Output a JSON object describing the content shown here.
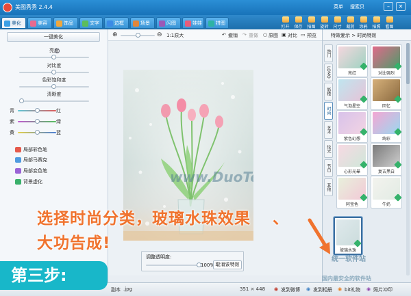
{
  "app": {
    "title": "美图秀秀 2.4.4",
    "menu_label": "菜单",
    "login_label": "搜索贝",
    "minimize": "–",
    "close": "✕"
  },
  "tabs": [
    {
      "label": "美化",
      "icon": "beautify-icon",
      "active": true
    },
    {
      "label": "美容",
      "icon": "makeup-icon",
      "active": false
    },
    {
      "label": "饰品",
      "icon": "accessory-icon",
      "active": false
    },
    {
      "label": "文字",
      "icon": "text-icon",
      "active": false
    },
    {
      "label": "边框",
      "icon": "frame-icon",
      "active": false
    },
    {
      "label": "场景",
      "icon": "scene-icon",
      "active": false
    },
    {
      "label": "闪图",
      "icon": "flash-icon",
      "active": false
    },
    {
      "label": "娃娃",
      "icon": "doll-icon",
      "active": false
    },
    {
      "label": "拼图",
      "icon": "puzzle-icon",
      "active": false
    }
  ],
  "toolbar": [
    {
      "label": "打开",
      "icon": "open-icon"
    },
    {
      "label": "保存",
      "icon": "save-icon"
    },
    {
      "label": "拍图",
      "icon": "camera-icon"
    },
    {
      "label": "旋转",
      "icon": "rotate-icon"
    },
    {
      "label": "尺寸",
      "icon": "resize-icon"
    },
    {
      "label": "裁剪",
      "icon": "crop-icon"
    },
    {
      "label": "涂鸦",
      "icon": "doodle-icon"
    },
    {
      "label": "拍照",
      "icon": "photo-icon"
    },
    {
      "label": "看图",
      "icon": "view-icon"
    }
  ],
  "left_panel": {
    "one_key_button": "一键美化",
    "brightness": "亮度",
    "contrast": "对比度",
    "saturation": "色彩饱和度",
    "sharpness": "清晰度",
    "color_pairs": [
      {
        "left": "青",
        "right": "红"
      },
      {
        "left": "紫",
        "right": "绿"
      },
      {
        "left": "黄",
        "right": "蓝"
      }
    ],
    "features": [
      {
        "label": "局部彩色笔",
        "icon": "color-pen-icon",
        "color": "#e55a4c"
      },
      {
        "label": "局部马赛克",
        "icon": "mosaic-icon",
        "color": "#4f9be0"
      },
      {
        "label": "局部变色笔",
        "icon": "recolor-pen-icon",
        "color": "#9a63d6"
      },
      {
        "label": "背景虚化",
        "icon": "blur-icon",
        "color": "#39b06a"
      }
    ]
  },
  "canvas_toolbar": {
    "zoom_ratio": "1:1原大",
    "undo": "撤销",
    "redo": "重做",
    "original": "原图",
    "compare": "对比",
    "preview": "预览"
  },
  "opacity_box": {
    "label": "调整透明度:",
    "value": "100%",
    "cancel_button": "取消该特效",
    "level": 1.0
  },
  "status": {
    "file_prefix": "副本",
    "file_ext": ".jpg",
    "dimensions": "351 × 448",
    "links": [
      "发到微博",
      "发到相册",
      "bit礼物",
      "照片冲印"
    ]
  },
  "right_panel": {
    "breadcrumb": "特效爱示 > 时尚特效",
    "vtabs": [
      "热门",
      "LOMO",
      "影楼",
      "时尚",
      "艺术",
      "炫光",
      "节日",
      "其他"
    ],
    "active_vtab": 3,
    "effects": [
      {
        "label": "亮红",
        "c1": "#f4d7de",
        "c2": "#9fd3c2"
      },
      {
        "label": "对比强烈",
        "c1": "#e06a8a",
        "c2": "#4f9a6a"
      },
      {
        "label": "气泡星空",
        "c1": "#bfe5ef",
        "c2": "#e7c3d7"
      },
      {
        "label": "回忆",
        "c1": "#d6b07a",
        "c2": "#8a6a40"
      },
      {
        "label": "紫色幻想",
        "c1": "#d8c2ea",
        "c2": "#f2d4e3"
      },
      {
        "label": "绚彩",
        "c1": "#f4a6d3",
        "c2": "#9ad8f0"
      },
      {
        "label": "心形光晕",
        "c1": "#f7d9e3",
        "c2": "#cfe7d9"
      },
      {
        "label": "复古黑白",
        "c1": "#7a7a7a",
        "c2": "#cfcfcf"
      },
      {
        "label": "阿宝色",
        "c1": "#e8f0dc",
        "c2": "#f2c9d6"
      },
      {
        "label": "牛奶",
        "c1": "#f3f3ee",
        "c2": "#e2ebe4"
      },
      {
        "label": "玻璃水珠",
        "c1": "#dfe9ec",
        "c2": "#cbdcdc"
      }
    ],
    "selected_effect": 10
  },
  "overlay": {
    "caption_line1": "选择时尚分类，玻璃水珠效果",
    "caption_line2": "大功告成!",
    "arrow_mark": "、",
    "step_badge": "第三步:",
    "photo_watermark": "www.DuoTe.com",
    "site_watermark": "统一软件站",
    "site_watermark2": "国内最安全的软件站"
  },
  "colors": {
    "title_blue": "#1873b9",
    "caption_orange": "#f0732e",
    "badge_teal": "#18b7c9"
  }
}
